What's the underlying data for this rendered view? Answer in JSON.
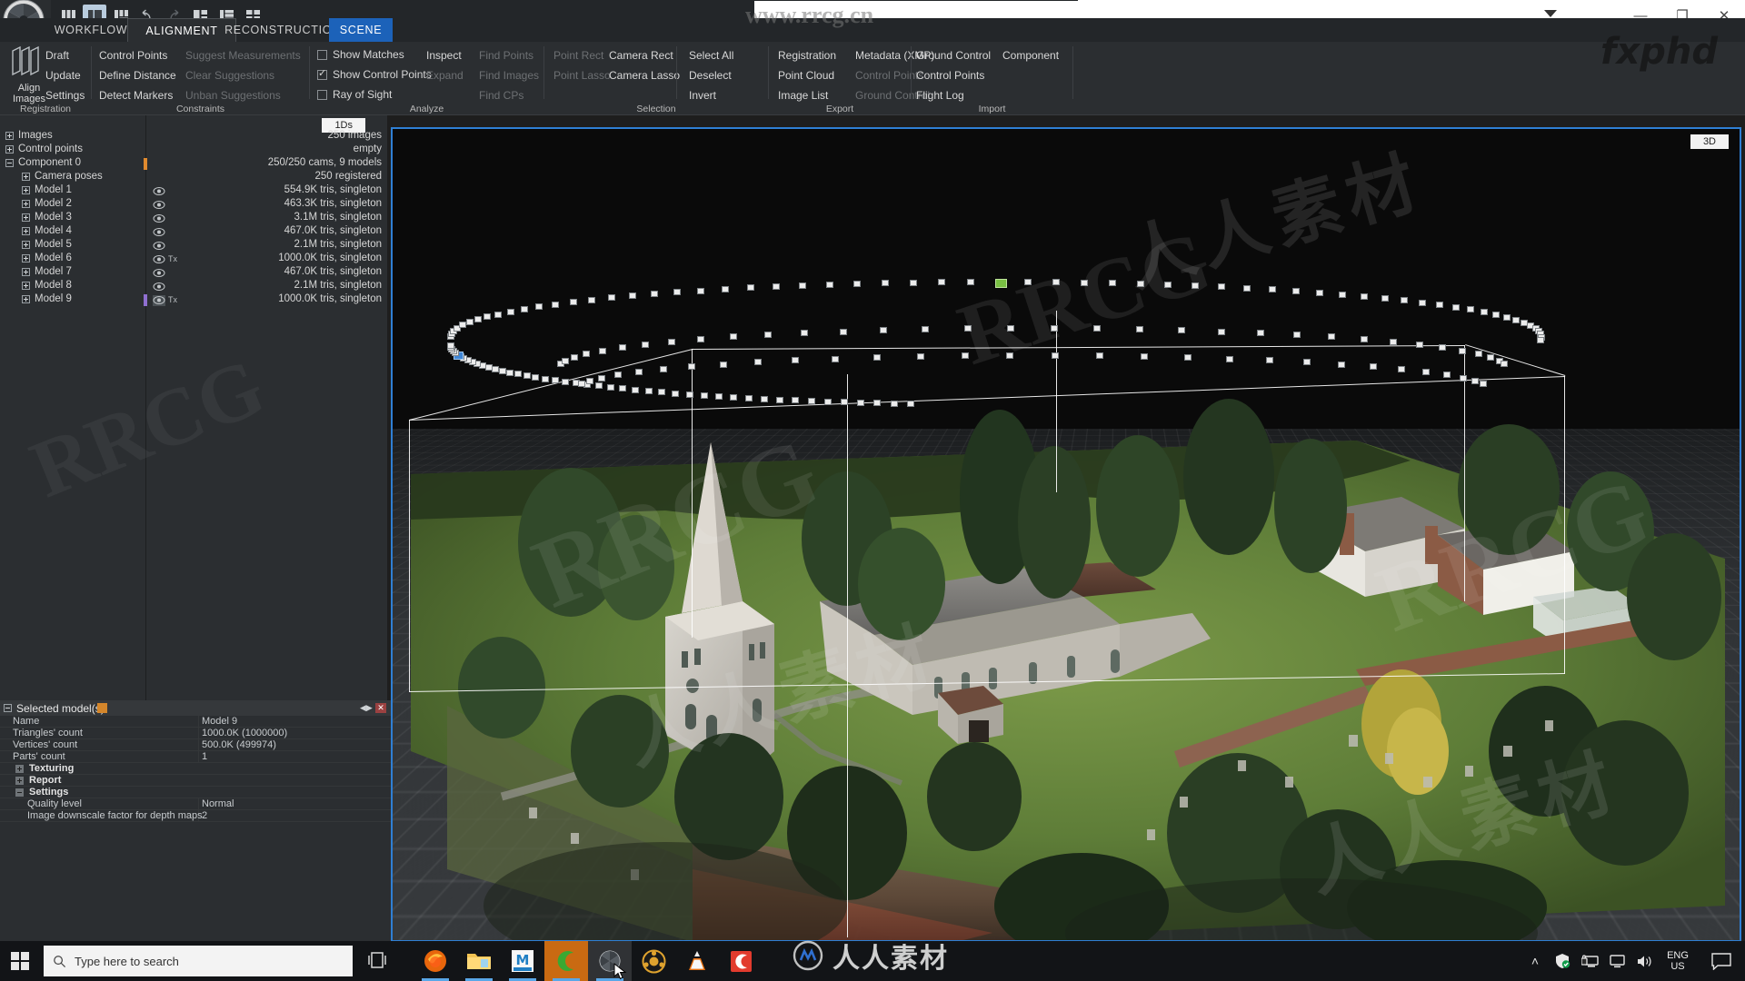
{
  "app": {
    "title_icons": [
      "layout-3col-icon",
      "layout-2col-icon",
      "layout-split-icon",
      "undo-icon",
      "redo-icon",
      "grid-2-icon",
      "grid-list-icon",
      "grid-4-icon"
    ],
    "quick_field_value": ""
  },
  "window_controls": {
    "minimize": "—",
    "maximize": "❐",
    "close": "✕"
  },
  "tabs": [
    {
      "label": "WORKFLOW",
      "active": false
    },
    {
      "label": "ALIGNMENT",
      "active": true
    },
    {
      "label": "RECONSTRUCTION",
      "active": false
    },
    {
      "label": "SCENE",
      "active": false,
      "highlight": true
    }
  ],
  "ribbon": {
    "groups": [
      {
        "name": "Registration",
        "label": "Registration",
        "big_button": {
          "label_line1": "Align",
          "label_line2": "Images",
          "icon": "align-images-icon"
        },
        "items": [
          {
            "label": "Draft",
            "disabled": false
          },
          {
            "label": "Update",
            "disabled": false
          },
          {
            "label": "Settings",
            "disabled": false
          }
        ]
      },
      {
        "name": "Constraints",
        "label": "Constraints",
        "items": [
          {
            "label": "Control Points",
            "disabled": false
          },
          {
            "label": "Suggest Measurements",
            "disabled": true
          },
          {
            "label": "Define Distance",
            "disabled": false
          },
          {
            "label": "Clear Suggestions",
            "disabled": true
          },
          {
            "label": "Detect Markers",
            "disabled": false
          },
          {
            "label": "Unban Suggestions",
            "disabled": true
          }
        ]
      },
      {
        "name": "Analyze",
        "label": "Analyze",
        "checkboxes": [
          {
            "label": "Show Matches",
            "checked": false
          },
          {
            "label": "Show Control Points",
            "checked": true
          },
          {
            "label": "Ray of Sight",
            "checked": false
          }
        ],
        "items": [
          {
            "label": "Inspect",
            "disabled": false
          },
          {
            "label": "Find Points",
            "disabled": true
          },
          {
            "label": "Expand",
            "disabled": true
          },
          {
            "label": "Find Images",
            "disabled": true
          },
          {
            "label": "Find CPs",
            "disabled": true
          }
        ]
      },
      {
        "name": "Selection",
        "label": "Selection",
        "items": [
          {
            "label": "Point Rect",
            "disabled": true
          },
          {
            "label": "Camera Rect",
            "disabled": false
          },
          {
            "label": "Select All",
            "disabled": false
          },
          {
            "label": "Point Lasso",
            "disabled": true
          },
          {
            "label": "Camera Lasso",
            "disabled": false
          },
          {
            "label": "Deselect",
            "disabled": false
          },
          {
            "label": "Invert",
            "disabled": false
          }
        ]
      },
      {
        "name": "Export",
        "label": "Export",
        "items": [
          {
            "label": "Registration",
            "disabled": false
          },
          {
            "label": "Metadata (XMP)",
            "disabled": false
          },
          {
            "label": "Point Cloud",
            "disabled": false
          },
          {
            "label": "Control Points",
            "disabled": true
          },
          {
            "label": "Image List",
            "disabled": false
          },
          {
            "label": "Ground Control",
            "disabled": true
          }
        ]
      },
      {
        "name": "Import",
        "label": "Import",
        "items": [
          {
            "label": "Ground Control",
            "disabled": false
          },
          {
            "label": "Component",
            "disabled": false
          },
          {
            "label": "Control Points",
            "disabled": false
          },
          {
            "label": "Flight Log",
            "disabled": false
          }
        ]
      }
    ]
  },
  "tree": {
    "view_badge": "1Ds",
    "rows": [
      {
        "label": "Images",
        "indent": 0,
        "expander": "plus",
        "value": "250 images",
        "eye": false,
        "tx": false,
        "selected": false
      },
      {
        "label": "Control points",
        "indent": 0,
        "expander": "plus",
        "value": "empty",
        "eye": false,
        "tx": false,
        "selected": false
      },
      {
        "label": "Component 0",
        "indent": 0,
        "expander": "minus",
        "value": "250/250 cams, 9 models",
        "eye": false,
        "tx": false,
        "selected": false,
        "marker": "#e08a2e"
      },
      {
        "label": "Camera poses",
        "indent": 1,
        "expander": "plus",
        "value": "250 registered",
        "eye": false,
        "tx": false,
        "selected": false
      },
      {
        "label": "Model 1",
        "indent": 1,
        "expander": "plus",
        "value": "554.9K tris, singleton",
        "eye": true,
        "tx": false,
        "selected": false
      },
      {
        "label": "Model 2",
        "indent": 1,
        "expander": "plus",
        "value": "463.3K tris, singleton",
        "eye": true,
        "tx": false,
        "selected": false
      },
      {
        "label": "Model 3",
        "indent": 1,
        "expander": "plus",
        "value": "3.1M tris, singleton",
        "eye": true,
        "tx": false,
        "selected": false
      },
      {
        "label": "Model 4",
        "indent": 1,
        "expander": "plus",
        "value": "467.0K tris, singleton",
        "eye": true,
        "tx": false,
        "selected": false
      },
      {
        "label": "Model 5",
        "indent": 1,
        "expander": "plus",
        "value": "2.1M tris, singleton",
        "eye": true,
        "tx": false,
        "selected": false
      },
      {
        "label": "Model 6",
        "indent": 1,
        "expander": "plus",
        "value": "1000.0K tris, singleton",
        "eye": true,
        "tx": true,
        "selected": false
      },
      {
        "label": "Model 7",
        "indent": 1,
        "expander": "plus",
        "value": "467.0K tris, singleton",
        "eye": true,
        "tx": false,
        "selected": false
      },
      {
        "label": "Model 8",
        "indent": 1,
        "expander": "plus",
        "value": "2.1M tris, singleton",
        "eye": true,
        "tx": false,
        "selected": false
      },
      {
        "label": "Model 9",
        "indent": 1,
        "expander": "plus",
        "value": "1000.0K tris, singleton",
        "eye": true,
        "tx": true,
        "selected": true,
        "marker": "#8f6fd0"
      }
    ]
  },
  "properties": {
    "title": "Selected model(s)",
    "rows": [
      {
        "key": "Name",
        "value": "Model 9",
        "type": "field"
      },
      {
        "key": "Triangles' count",
        "value": "1000.0K (1000000)",
        "type": "field"
      },
      {
        "key": "Vertices' count",
        "value": "500.0K (499974)",
        "type": "field"
      },
      {
        "key": "Parts' count",
        "value": "1",
        "type": "field"
      },
      {
        "key": "Texturing",
        "value": "",
        "type": "group",
        "expanded": false
      },
      {
        "key": "Report",
        "value": "",
        "type": "group",
        "expanded": false
      },
      {
        "key": "Settings",
        "value": "",
        "type": "group",
        "expanded": true
      },
      {
        "key": "Quality level",
        "value": "Normal",
        "type": "sub"
      },
      {
        "key": "Image downscale factor for depth maps",
        "value": "2",
        "type": "sub"
      }
    ]
  },
  "viewport": {
    "badge": "3D",
    "scene_name": "church-aerial-photogrammetry-model",
    "selected_camera_color": "#79c043",
    "highlight_camera_color": "#3f86d6",
    "bounding_box_color": "#ffffff"
  },
  "watermarks": {
    "url": "www.rrcg.cn",
    "brand": "RRCG",
    "cn_text": "人人素材",
    "fxphd": "fxphd",
    "bottom_logo_text": "人人素材"
  },
  "taskbar": {
    "search_placeholder": "Type here to search",
    "start_icon": "windows-start-icon",
    "task_view_icon": "task-view-icon",
    "apps": [
      {
        "name": "firefox-icon",
        "running": true,
        "active": false
      },
      {
        "name": "file-explorer-icon",
        "running": true,
        "active": false
      },
      {
        "name": "meshmixer-icon",
        "running": true,
        "active": false
      },
      {
        "name": "capture-one-icon",
        "running": true,
        "active": true
      },
      {
        "name": "realitycapture-icon",
        "running": true,
        "active": false
      },
      {
        "name": "media-player-icon",
        "running": false,
        "active": false
      },
      {
        "name": "vlc-icon",
        "running": false,
        "active": false
      },
      {
        "name": "c-app-icon",
        "running": false,
        "active": false
      }
    ],
    "tray": {
      "chevron": "˄",
      "icons": [
        "security-shield-icon",
        "network-secure-icon",
        "display-icon",
        "volume-icon"
      ],
      "language_line1": "ENG",
      "language_line2": "US",
      "action_center": "notifications-icon"
    }
  }
}
